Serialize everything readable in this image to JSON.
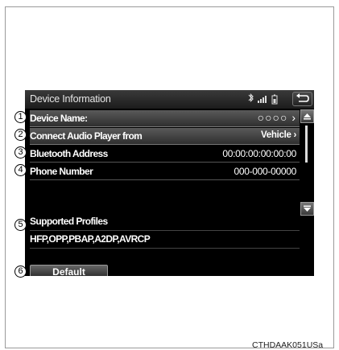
{
  "header": {
    "title": "Device Information",
    "status_icons": [
      "bluetooth-icon",
      "signal-bars-icon",
      "battery-icon"
    ],
    "back_icon": "back-arrow-icon"
  },
  "rows": [
    {
      "label": "Device Name:",
      "value": "○○○○ ›"
    },
    {
      "label": "Connect Audio Player from",
      "value": "Vehicle ›"
    },
    {
      "label": "Bluetooth Address",
      "value": "00:00:00:00:00:00"
    },
    {
      "label": "Phone Number",
      "value": "000-000-00000"
    }
  ],
  "profiles": {
    "label": "Supported Profiles",
    "value": "HFP,OPP,PBAP,A2DP,AVRCP"
  },
  "default_button": {
    "label": "Default"
  },
  "callouts": [
    "1",
    "2",
    "3",
    "4",
    "5",
    "6"
  ],
  "caption": "CTHDAAK051USa",
  "colors": {
    "screen_bg": "#000000",
    "highlight": "#5a5a5a",
    "text": "#ffffff"
  }
}
